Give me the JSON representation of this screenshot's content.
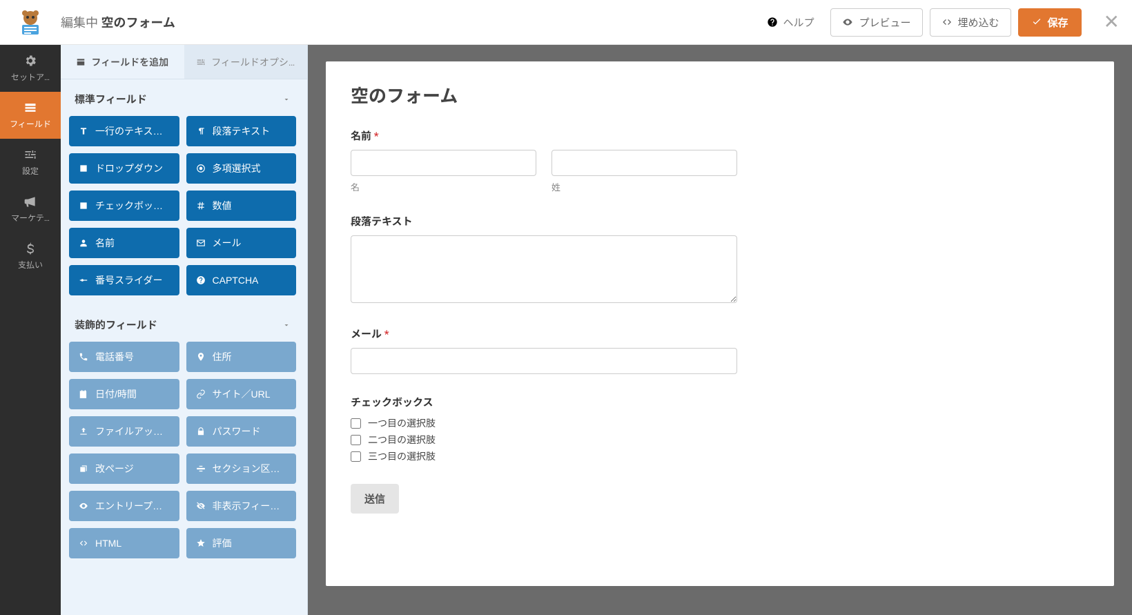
{
  "topbar": {
    "editing": "編集中",
    "form_name": "空のフォーム",
    "help": "ヘルプ",
    "preview": "プレビュー",
    "embed": "埋め込む",
    "save": "保存"
  },
  "leftnav": {
    "setup": "セットア…",
    "fields": "フィールド",
    "settings": "設定",
    "marketing": "マーケテ…",
    "payments": "支払い"
  },
  "sidebar": {
    "tab_add": "フィールドを追加",
    "tab_options": "フィールドオプシ…",
    "groups": {
      "standard": {
        "title": "標準フィールド",
        "items": [
          {
            "label": "一行のテキスト入力",
            "icon": "text"
          },
          {
            "label": "段落テキスト",
            "icon": "paragraph"
          },
          {
            "label": "ドロップダウン",
            "icon": "dropdown"
          },
          {
            "label": "多項選択式",
            "icon": "radio"
          },
          {
            "label": "チェックボックス",
            "icon": "checkbox"
          },
          {
            "label": "数値",
            "icon": "hash"
          },
          {
            "label": "名前",
            "icon": "user"
          },
          {
            "label": "メール",
            "icon": "mail"
          },
          {
            "label": "番号スライダー",
            "icon": "slider"
          },
          {
            "label": "CAPTCHA",
            "icon": "help"
          }
        ]
      },
      "fancy": {
        "title": "装飾的フィールド",
        "items": [
          {
            "label": "電話番号",
            "icon": "phone"
          },
          {
            "label": "住所",
            "icon": "pin"
          },
          {
            "label": "日付/時間",
            "icon": "calendar"
          },
          {
            "label": "サイト／URL",
            "icon": "link"
          },
          {
            "label": "ファイルアップロ…",
            "icon": "upload"
          },
          {
            "label": "パスワード",
            "icon": "lock"
          },
          {
            "label": "改ページ",
            "icon": "copy"
          },
          {
            "label": "セクション区切り",
            "icon": "divider"
          },
          {
            "label": "エントリープレビ…",
            "icon": "eye"
          },
          {
            "label": "非表示フィールド",
            "icon": "eyeoff"
          },
          {
            "label": "HTML",
            "icon": "code"
          },
          {
            "label": "評価",
            "icon": "star"
          }
        ]
      }
    }
  },
  "form": {
    "title": "空のフォーム",
    "name_label": "名前",
    "first_sub": "名",
    "last_sub": "姓",
    "paragraph_label": "段落テキスト",
    "email_label": "メール",
    "checkbox_label": "チェックボックス",
    "cb_options": [
      "一つ目の選択肢",
      "二つ目の選択肢",
      "三つ目の選択肢"
    ],
    "submit": "送信"
  }
}
